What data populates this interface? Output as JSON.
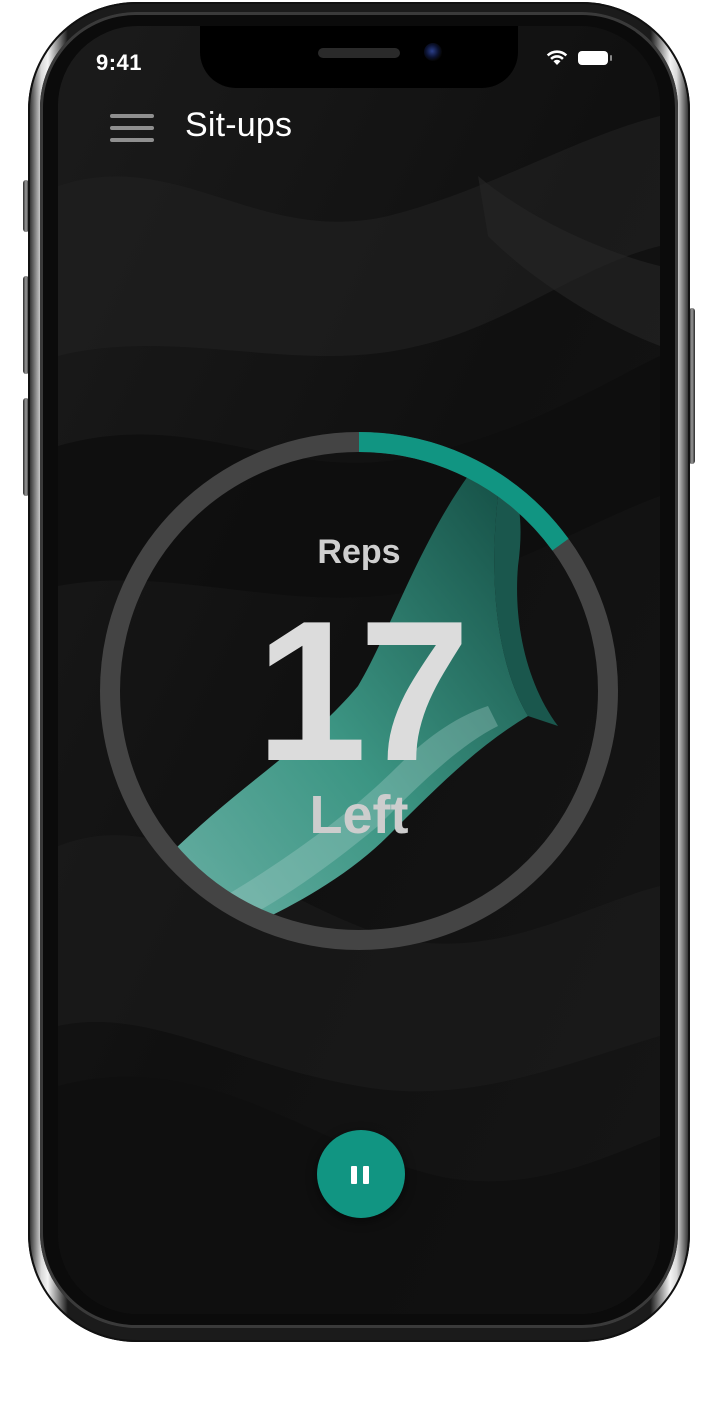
{
  "status_bar": {
    "time": "9:41",
    "icons": [
      "wifi-icon",
      "battery-icon"
    ]
  },
  "header": {
    "menu_icon": "hamburger-menu-icon",
    "title": "Sit-ups"
  },
  "workout": {
    "label_top": "Reps",
    "count": "17",
    "label_bottom": "Left",
    "progress_fraction": 0.15
  },
  "controls": {
    "pause_icon": "pause-icon"
  },
  "colors": {
    "accent": "#119582",
    "ring_track": "#444444",
    "background": "#121212",
    "text_primary": "#ffffff",
    "text_secondary": "#cfcfcf"
  }
}
